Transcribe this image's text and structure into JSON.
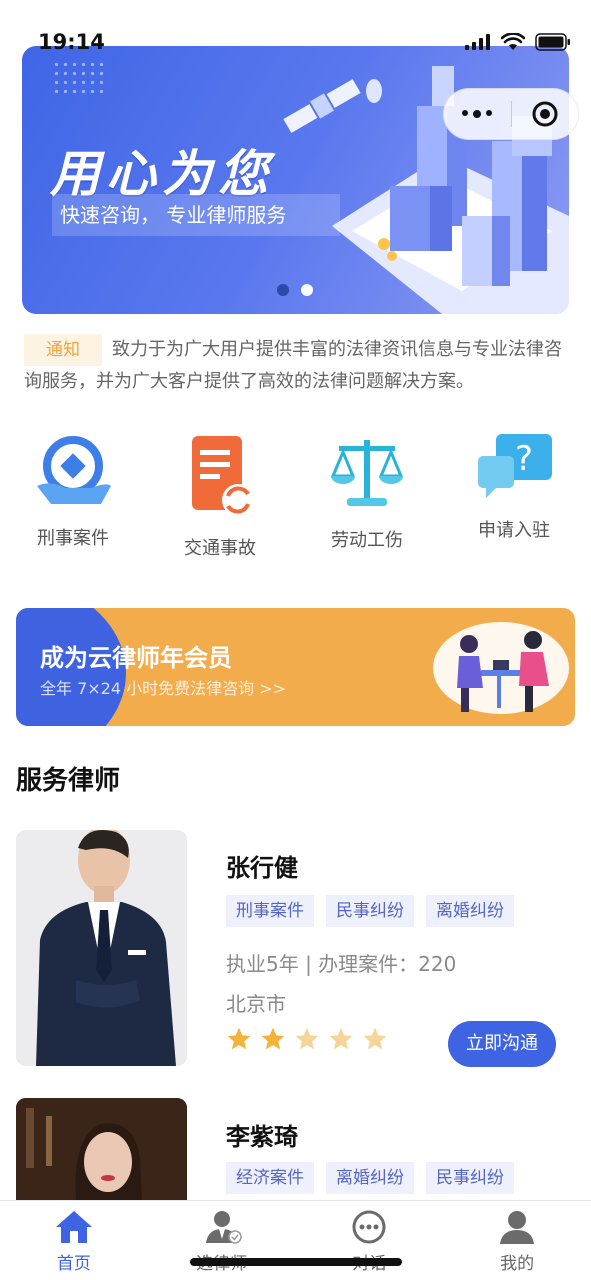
{
  "status_bar": {
    "time": "19:14"
  },
  "banner": {
    "title": "用心为您",
    "subtitle": "快速咨询， 专业律师服务",
    "slide_count": 2,
    "active_slide": 2
  },
  "notice": {
    "tag": "通知",
    "text": "致力于为广大用户提供丰富的法律资讯信息与专业法律咨询服务，并为广大客户提供了高效的法律问题解决方案。"
  },
  "categories": [
    {
      "label": "刑事案件",
      "icon": "hand-coin-icon"
    },
    {
      "label": "交通事故",
      "icon": "document-refresh-icon"
    },
    {
      "label": "劳动工伤",
      "icon": "scale-icon"
    },
    {
      "label": "申请入驻",
      "icon": "question-chat-icon"
    }
  ],
  "promo": {
    "title": "成为云律师年会员",
    "subtitle": "全年 7×24 小时免费法律咨询 >>"
  },
  "section_title": "服务律师",
  "lawyers": [
    {
      "name": "张行健",
      "tags": [
        "刑事案件",
        "民事纠纷",
        "离婚纠纷"
      ],
      "experience": "执业5年 | 办理案件：220",
      "city": "北京市",
      "rating": 2,
      "rating_max": 5,
      "action": "立即沟通"
    },
    {
      "name": "李紫琦",
      "tags": [
        "经济案件",
        "离婚纠纷",
        "民事纠纷"
      ]
    }
  ],
  "tabbar": [
    {
      "label": "首页",
      "icon": "home-icon",
      "active": true
    },
    {
      "label": "选律师",
      "icon": "lawyer-icon",
      "active": false
    },
    {
      "label": "对话",
      "icon": "chat-icon",
      "active": false
    },
    {
      "label": "我的",
      "icon": "user-icon",
      "active": false
    }
  ],
  "colors": {
    "primary": "#3e63e3",
    "notice_tag_bg": "#fdf3e3",
    "notice_tag_text": "#f0a43a",
    "promo_bg": "#f3ac4c",
    "star": "#f3b23a"
  }
}
